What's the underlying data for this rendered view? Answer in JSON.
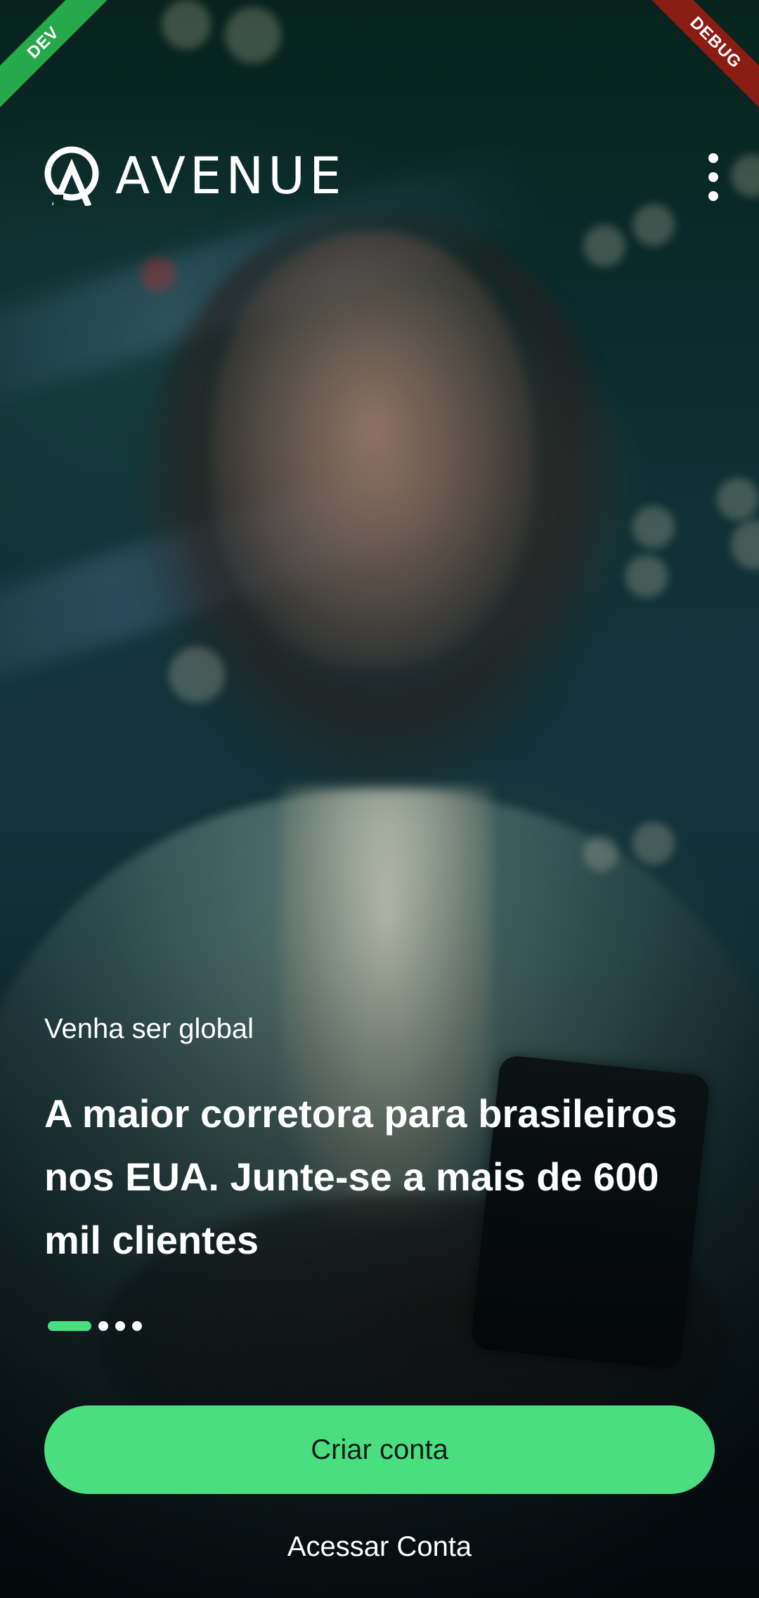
{
  "ribbons": {
    "left": "DEV",
    "right": "DEBUG"
  },
  "header": {
    "logo_text": "AVENUE",
    "logo_icon": "avenue-a-logo",
    "menu_icon": "more-vertical-icon"
  },
  "hero": {
    "eyebrow": "Venha ser global",
    "headline": "A maior corretora para brasileiros nos EUA. Junte-se a mais de 600 mil clientes"
  },
  "pager": {
    "total": 4,
    "active_index": 0
  },
  "actions": {
    "primary_label": "Criar conta",
    "secondary_label": "Acessar Conta"
  },
  "colors": {
    "accent": "#4ade80",
    "ribbon_dev": "#27a84a",
    "ribbon_debug": "#8b1c14",
    "text": "#ffffff"
  }
}
